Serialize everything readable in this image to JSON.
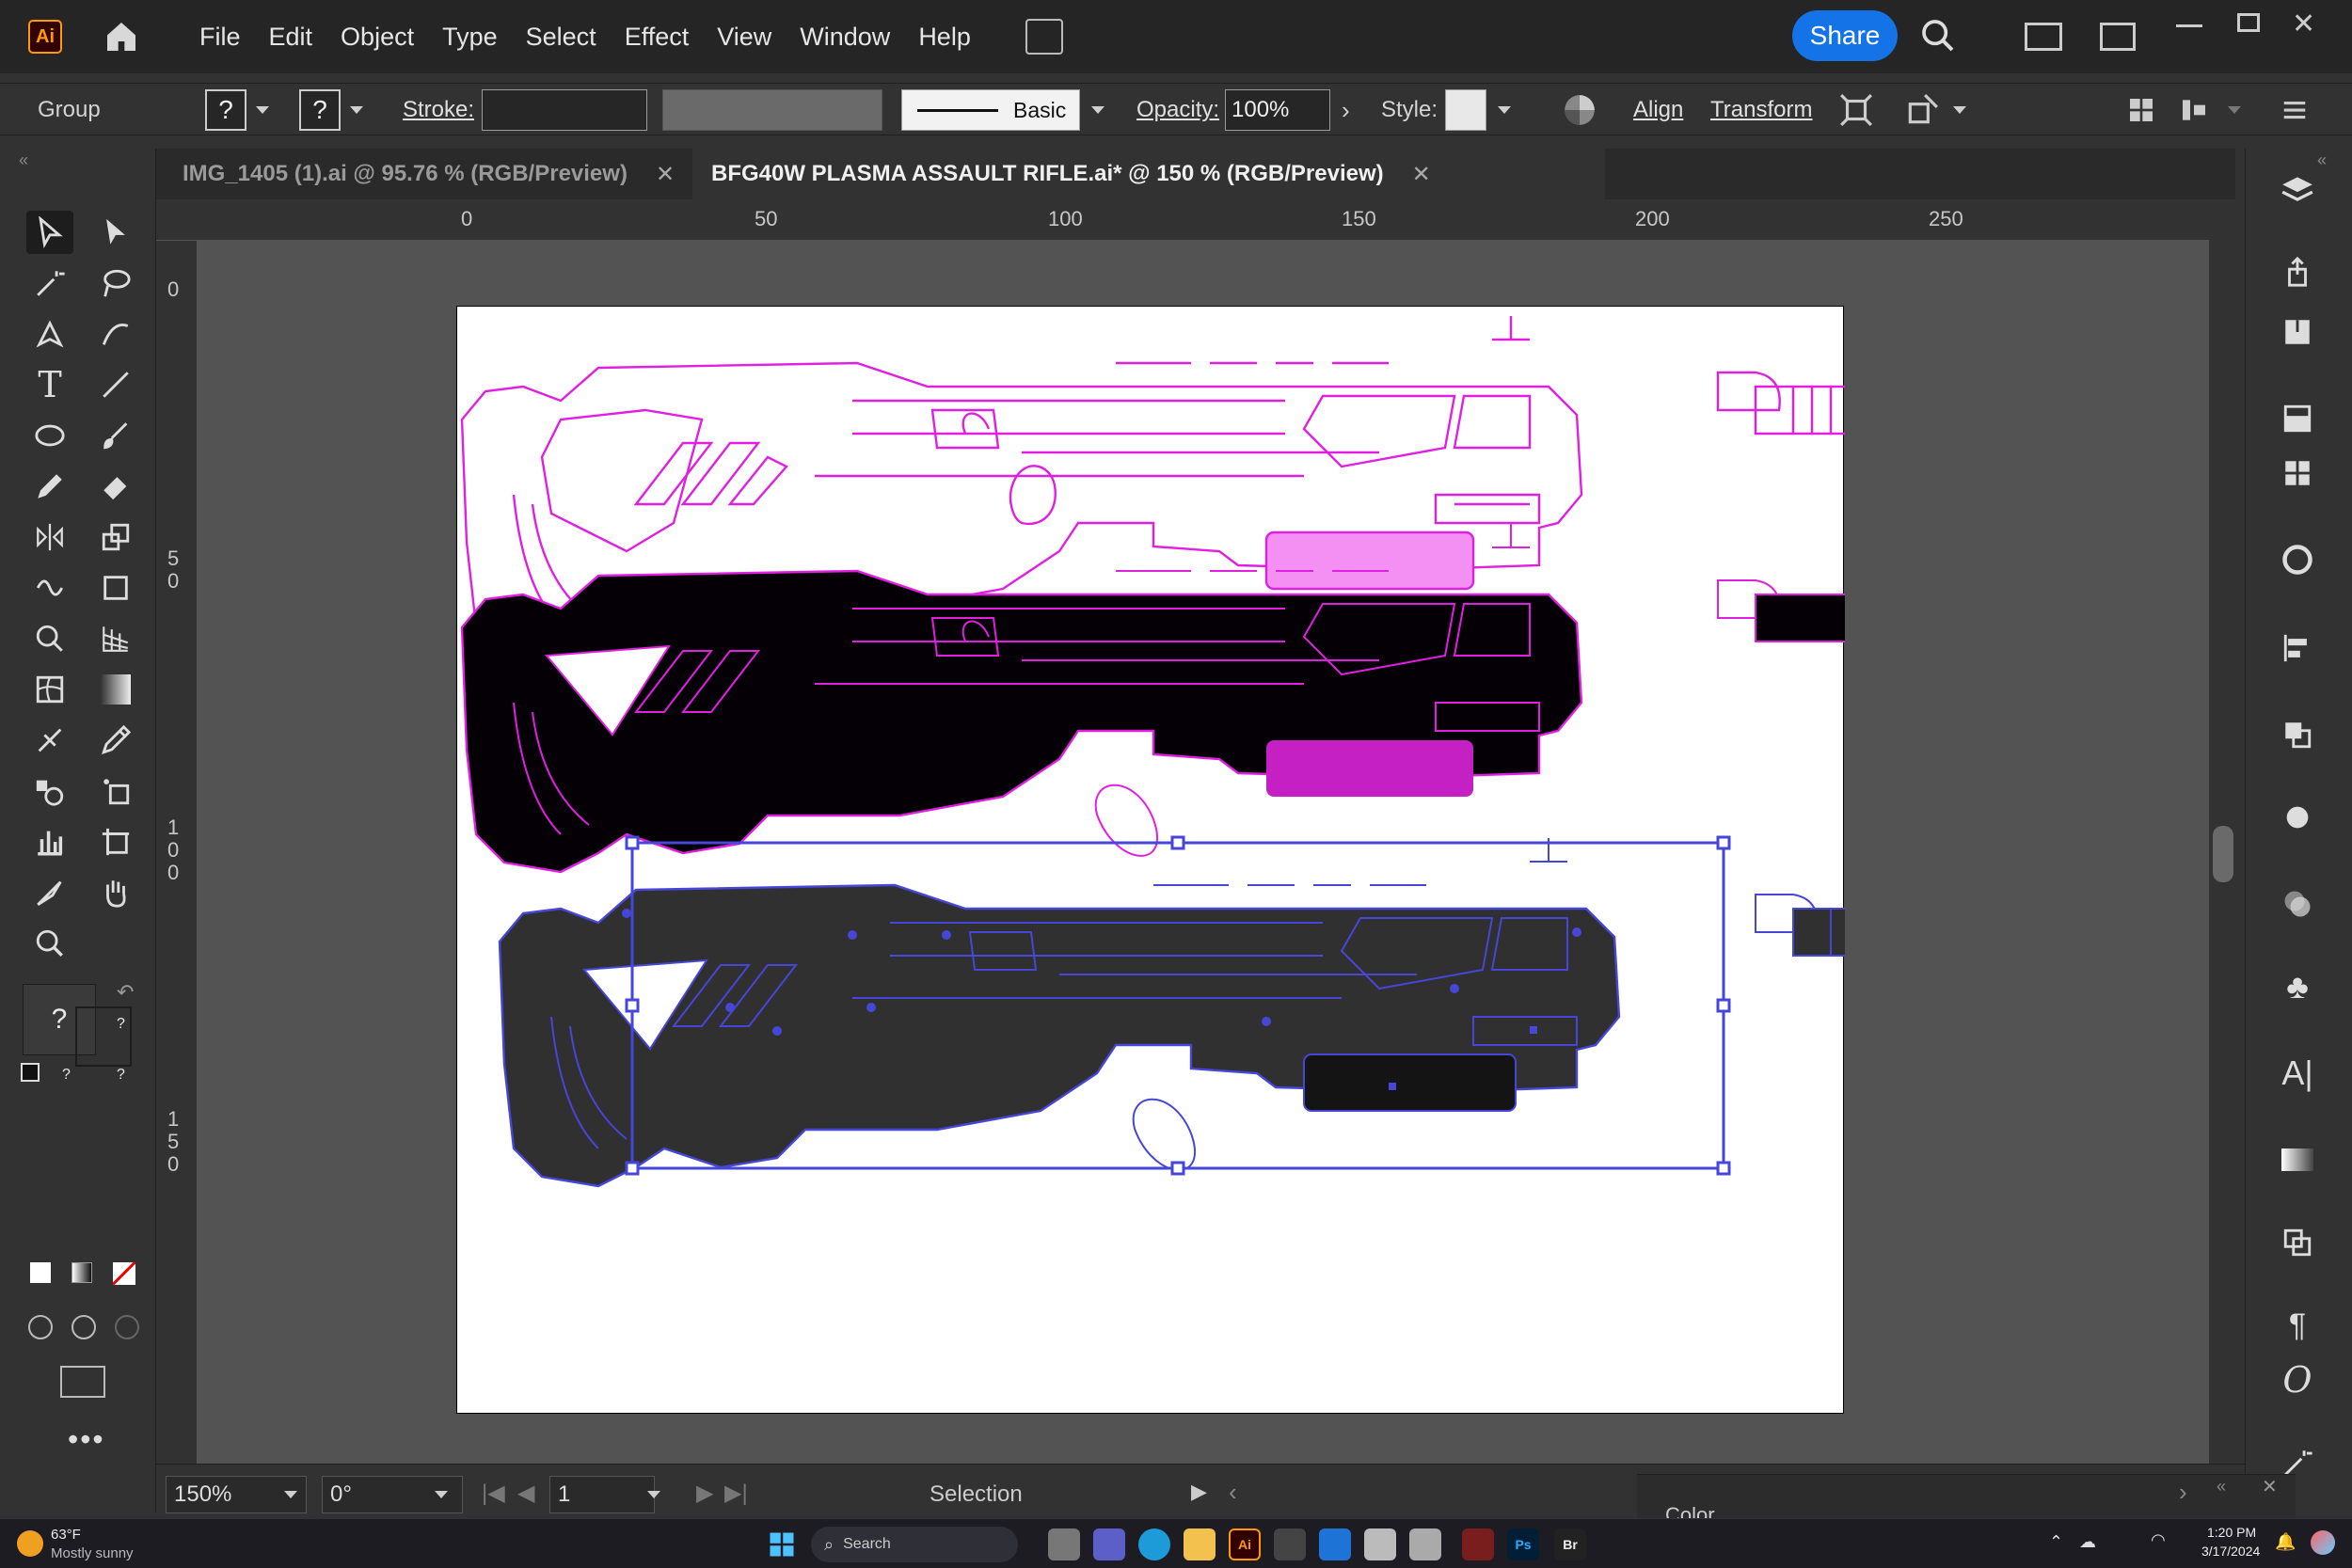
{
  "app": {
    "logo": "Ai",
    "share_label": "Share"
  },
  "menu": [
    "File",
    "Edit",
    "Object",
    "Type",
    "Select",
    "Effect",
    "View",
    "Window",
    "Help"
  ],
  "control_bar": {
    "selection_type": "Group",
    "fill_value": "?",
    "stroke_swatch_value": "?",
    "stroke_label": "Stroke:",
    "brush_label": "Basic",
    "opacity_label": "Opacity:",
    "opacity_value": "100%",
    "style_label": "Style:",
    "align_label": "Align",
    "transform_label": "Transform"
  },
  "tabs": [
    {
      "label": "IMG_1405 (1).ai @ 95.76 % (RGB/Preview)",
      "active": false
    },
    {
      "label": "BFG40W PLASMA ASSAULT RIFLE.ai* @ 150 % (RGB/Preview)",
      "active": true
    }
  ],
  "ruler": {
    "top": [
      "0",
      "50",
      "100",
      "150",
      "200",
      "250"
    ],
    "left": [
      "0",
      "5\n0",
      "1\n0\n0",
      "1\n5\n0"
    ]
  },
  "tool_panel": {
    "fill_stroke_unknown": "?",
    "small_question": "?"
  },
  "status": {
    "zoom": "150%",
    "rotation": "0°",
    "artboard": "1",
    "tool": "Selection"
  },
  "bottom_panel_title": "Color",
  "taskbar": {
    "weather_temp": "63°F",
    "weather_desc": "Mostly sunny",
    "search_label": "Search",
    "time": "1:20 PM",
    "date": "3/17/2024"
  },
  "colors": {
    "accent": "#1473e6",
    "magenta": "#e020e0",
    "blue": "#5050e0",
    "artboard": "#ffffff"
  },
  "icons": [
    "home-icon",
    "search-icon",
    "arrange-documents-icon",
    "minimize-icon",
    "maximize-icon",
    "close-icon"
  ]
}
